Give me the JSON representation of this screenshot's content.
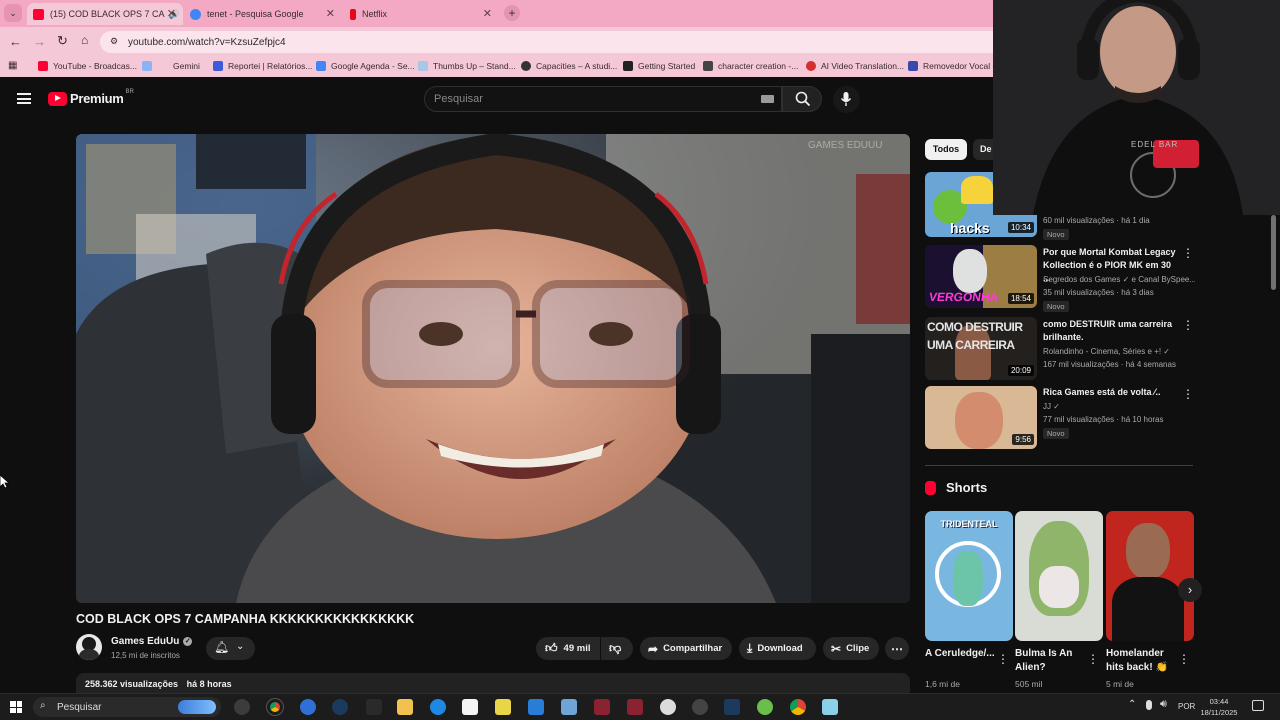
{
  "browser": {
    "tabs": [
      {
        "title": "(15) COD BLACK OPS 7 CA",
        "favicon_color": "#ff0033",
        "active": true
      },
      {
        "title": "tenet - Pesquisa Google",
        "favicon_color": "#4285f4",
        "active": false
      },
      {
        "title": "Netflix",
        "favicon_color": "#e50914",
        "active": false
      }
    ],
    "url": "youtube.com/watch?v=KzsuZefpjc4",
    "bookmarks": [
      {
        "label": "YouTube - Broadcas...",
        "color": "#ff0033"
      },
      {
        "label": "Gemini",
        "color": "#8ab4f8"
      },
      {
        "label": "Reportei | Relatórios...",
        "color": "#3b5bdb"
      },
      {
        "label": "Google Agenda - Se...",
        "color": "#4285f4"
      },
      {
        "label": "Thumbs Up – Stand...",
        "color": "#a7c7e7"
      },
      {
        "label": "Capacities – A studi...",
        "color": "#333333"
      },
      {
        "label": "Getting Started",
        "color": "#222222"
      },
      {
        "label": "character creation -...",
        "color": "#444444"
      },
      {
        "label": "AI Video Translation...",
        "color": "#d32f2f"
      },
      {
        "label": "Removedor Vocal e",
        "color": "#3949ab"
      }
    ]
  },
  "youtube": {
    "logo_text": "Premium",
    "region": "BR",
    "search_placeholder": "Pesquisar",
    "video": {
      "watermark": "GAMES EDUUU",
      "title": "COD BLACK OPS 7 CAMPANHA KKKKKKKKKKKKKKKK",
      "channel": "Games EduUu",
      "subscribers": "12,5 mi de inscritos",
      "likes": "49 mil",
      "share_label": "Compartilhar",
      "download_label": "Download",
      "clip_label": "Clipe",
      "views": "258.362 visualizações",
      "age": "há 8 horas"
    },
    "chips": [
      "Todos",
      "De"
    ],
    "recommendations": [
      {
        "thumb_text": "hacks",
        "duration": "10:34",
        "title": "",
        "channel": "",
        "meta": "60 mil visualizações · há 1 dia",
        "badge": "Novo"
      },
      {
        "thumb_text": "VERGONHA",
        "duration": "18:54",
        "title": "Por que Mortal Kombat Legacy Kollection é o PIOR MK em 30 ...",
        "channel": "Segredos dos Games ✓ e Canal BySpee...",
        "meta": "35 mil visualizações · há 3 dias",
        "badge": "Novo"
      },
      {
        "thumb_text": "COMO DESTRUIR UMA CARREIRA",
        "duration": "20:09",
        "title": "como DESTRUIR uma carreira brilhante.",
        "channel": "Rolandinho - Cinema, Séries e +! ✓",
        "meta": "167 mil visualizações · há 4 semanas",
        "badge": ""
      },
      {
        "thumb_text": "",
        "duration": "9:56",
        "title": "Rica Games está de volta ⁄..",
        "channel": "JJ ✓",
        "meta": "77 mil visualizações · há 10 horas",
        "badge": "Novo"
      }
    ],
    "shorts_label": "Shorts",
    "shorts": [
      {
        "thumb_text": "TRIDENTEAL",
        "title": "A Ceruledge/...",
        "views": "1,6 mi de"
      },
      {
        "thumb_text": "",
        "title": "Bulma Is An Alien?",
        "views": "505 mil"
      },
      {
        "thumb_text": "",
        "title": "Homelander hits back! 👏",
        "views": "5 mi de"
      }
    ]
  },
  "webcam": {
    "shirt_text": "EDEL BAR"
  },
  "taskbar": {
    "search_label": "Pesquisar",
    "language": "POR",
    "time": "03:44",
    "date": "18/11/2025"
  }
}
